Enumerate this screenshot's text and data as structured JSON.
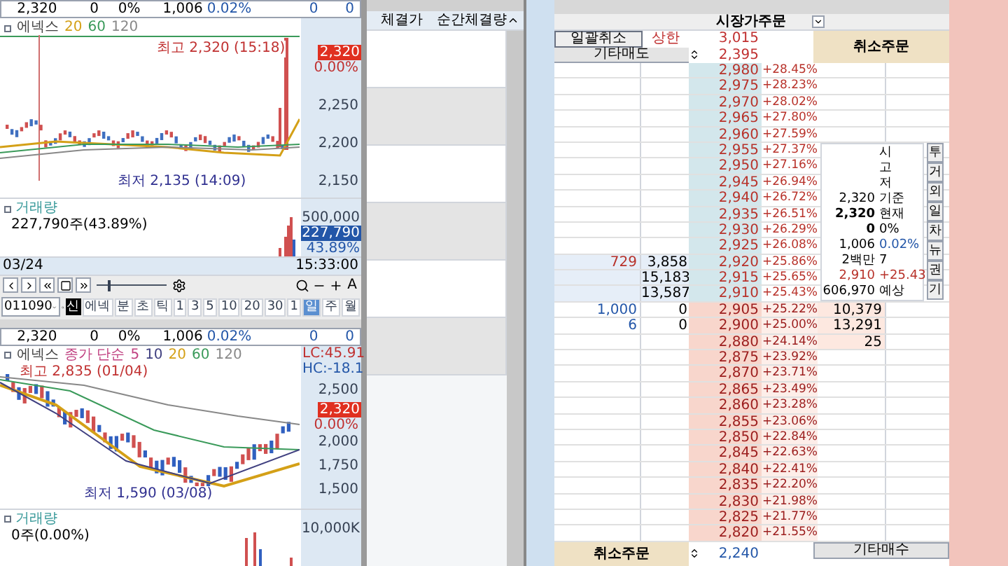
{
  "chart_panels": [
    {
      "quote": [
        {
          "text": "2,320",
          "kind": "plain"
        },
        {
          "text": "0",
          "kind": "plain"
        },
        {
          "text": "0%",
          "kind": "plain"
        },
        {
          "text": "1,006",
          "kind": "plain"
        },
        {
          "text": "0.02%",
          "kind": "blue"
        },
        {
          "text": "0",
          "kind": "blue"
        },
        {
          "text": "0",
          "kind": "blue"
        }
      ],
      "legend": [
        {
          "text": "에넥스",
          "color": "#404040"
        },
        {
          "text": "20",
          "color": "#d4a017"
        },
        {
          "text": "60",
          "color": "#3a9a5a"
        },
        {
          "text": "120",
          "color": "#888888"
        }
      ],
      "high_label": "최고 2,320 (15:18)",
      "low_label": "최저 2,135 (14:09)",
      "y_ticks": [
        "2,250",
        "2,200",
        "2,150"
      ],
      "price_tag": "2,320",
      "price_change": "0.00%",
      "volume": {
        "title": "거래량",
        "value": "227,790주(43.89%)",
        "tick": "500,000",
        "tag": "227,790",
        "tag_change": "43.89%"
      },
      "date": "03/24",
      "time": "15:33:00",
      "zoom_label": "A",
      "playback_slider": {
        "level": 0.15
      },
      "code_bar": {
        "code": "011090",
        "items": [
          {
            "label": "신",
            "kind": "badge"
          },
          {
            "label": "에넥",
            "kind": "tab",
            "selected": false
          },
          {
            "label": "분",
            "kind": "tab",
            "selected": false
          },
          {
            "label": "초",
            "kind": "tab",
            "selected": false
          },
          {
            "label": "틱",
            "kind": "tab",
            "selected": false
          },
          {
            "label": "1",
            "kind": "tab",
            "selected": false
          },
          {
            "label": "3",
            "kind": "tab",
            "selected": false
          },
          {
            "label": "5",
            "kind": "tab",
            "selected": false
          },
          {
            "label": "10",
            "kind": "tab",
            "selected": false
          },
          {
            "label": "20",
            "kind": "tab",
            "selected": false
          },
          {
            "label": "30",
            "kind": "tab",
            "selected": false
          },
          {
            "label": "1",
            "kind": "tab",
            "selected": false
          },
          {
            "label": "일",
            "kind": "tab",
            "selected": true
          },
          {
            "label": "주",
            "kind": "tab",
            "selected": false
          },
          {
            "label": "월",
            "kind": "tab",
            "selected": false
          }
        ]
      }
    },
    {
      "quote": [
        {
          "text": "2,320",
          "kind": "plain"
        },
        {
          "text": "0",
          "kind": "plain"
        },
        {
          "text": "0%",
          "kind": "plain"
        },
        {
          "text": "1,006",
          "kind": "plain"
        },
        {
          "text": "0.02%",
          "kind": "blue"
        },
        {
          "text": "0",
          "kind": "blue"
        },
        {
          "text": "0",
          "kind": "blue"
        }
      ],
      "legend": [
        {
          "text": "에넥스",
          "color": "#404040"
        },
        {
          "text": "종가 단순",
          "color": "#c04080"
        },
        {
          "text": "5",
          "color": "#c04080"
        },
        {
          "text": "10",
          "color": "#404080"
        },
        {
          "text": "20",
          "color": "#d4a017"
        },
        {
          "text": "60",
          "color": "#3a9a5a"
        },
        {
          "text": "120",
          "color": "#888888"
        }
      ],
      "high_label": "최고 2,835 (01/04)",
      "low_label": "최저 1,590 (03/08)",
      "indicators": [
        "LC:45.91",
        "HC:-18.1"
      ],
      "y_ticks": [
        "2,500",
        "2,000",
        "1,750",
        "1,500"
      ],
      "price_tag": "2,320",
      "price_change": "0.00%",
      "volume": {
        "title": "거래량",
        "value": "0주(0.00%)",
        "tick": "10,000K"
      }
    }
  ],
  "trades": {
    "columns": [
      "체결가",
      "순간체결량"
    ]
  },
  "order_book": {
    "header": "시장가주문",
    "cancel_all": "일괄취소",
    "upper_limit": "상한",
    "upper_price": "3,015",
    "other_sell": "기타매도",
    "start_price": "2,395",
    "cancel_order_top": "취소주문",
    "rows": [
      {
        "kind": "sell",
        "price": "2,980",
        "change": "+28.45%"
      },
      {
        "kind": "sell",
        "price": "2,975",
        "change": "+28.23%"
      },
      {
        "kind": "sell",
        "price": "2,970",
        "change": "+28.02%"
      },
      {
        "kind": "sell",
        "price": "2,965",
        "change": "+27.80%"
      },
      {
        "kind": "sell",
        "price": "2,960",
        "change": "+27.59%"
      },
      {
        "kind": "sell",
        "price": "2,955",
        "change": "+27.37%"
      },
      {
        "kind": "sell",
        "price": "2,950",
        "change": "+27.16%"
      },
      {
        "kind": "sell",
        "price": "2,945",
        "change": "+26.94%"
      },
      {
        "kind": "sell",
        "price": "2,940",
        "change": "+26.72%"
      },
      {
        "kind": "sell",
        "price": "2,935",
        "change": "+26.51%"
      },
      {
        "kind": "sell",
        "price": "2,930",
        "change": "+26.29%"
      },
      {
        "kind": "sell",
        "price": "2,925",
        "change": "+26.08%"
      },
      {
        "kind": "sell",
        "price": "2,920",
        "change": "+25.86%",
        "column_1": "729",
        "column_2": "3,858"
      },
      {
        "kind": "sell",
        "price": "2,915",
        "change": "+25.65%",
        "column_2": "15,183"
      },
      {
        "kind": "sell",
        "price": "2,910",
        "change": "+25.43%",
        "column_2": "13,587"
      },
      {
        "kind": "buy",
        "price": "2,905",
        "change": "+25.22%",
        "column_1": "1,000",
        "column_2": "0",
        "column_5": "10,379"
      },
      {
        "kind": "buy",
        "price": "2,900",
        "change": "+25.00%",
        "column_1": "6",
        "column_2": "0",
        "column_5": "13,291"
      },
      {
        "kind": "buy",
        "price": "2,880",
        "change": "+24.14%",
        "column_5": "25"
      },
      {
        "kind": "buy",
        "price": "2,875",
        "change": "+23.92%"
      },
      {
        "kind": "buy",
        "price": "2,870",
        "change": "+23.71%"
      },
      {
        "kind": "buy",
        "price": "2,865",
        "change": "+23.49%"
      },
      {
        "kind": "buy",
        "price": "2,860",
        "change": "+23.28%"
      },
      {
        "kind": "buy",
        "price": "2,855",
        "change": "+23.06%"
      },
      {
        "kind": "buy",
        "price": "2,850",
        "change": "+22.84%"
      },
      {
        "kind": "buy",
        "price": "2,845",
        "change": "+22.63%"
      },
      {
        "kind": "buy",
        "price": "2,840",
        "change": "+22.41%"
      },
      {
        "kind": "buy",
        "price": "2,835",
        "change": "+22.20%"
      },
      {
        "kind": "buy",
        "price": "2,830",
        "change": "+21.98%"
      },
      {
        "kind": "buy",
        "price": "2,825",
        "change": "+21.77%"
      },
      {
        "kind": "buy",
        "price": "2,820",
        "change": "+21.55%"
      }
    ],
    "summary": [
      {
        "unit": "시",
        "kind": "plain"
      },
      {
        "unit": "고",
        "kind": "plain"
      },
      {
        "unit": "저",
        "kind": "plain"
      },
      {
        "amount": "2,320",
        "unit": "기준",
        "kind": "plain"
      },
      {
        "amount": "2,320",
        "unit": "현재",
        "kind": "bold"
      },
      {
        "amount": "0",
        "unit": "0%",
        "kind": "bold"
      },
      {
        "amount": "1,006",
        "unit": "0.02%",
        "kind": "blue"
      },
      {
        "amount": "2백만",
        "unit": "7",
        "kind": "plain"
      },
      {
        "amount": "2,910",
        "unit": "+25.43",
        "kind": "red"
      },
      {
        "amount": "606,970",
        "unit": "예상",
        "kind": "plain"
      }
    ],
    "side_buttons": [
      "투",
      "거",
      "외",
      "일",
      "차",
      "뉴",
      "권",
      "기"
    ],
    "cancel_order_bottom": "취소주문",
    "end_price": "2,240",
    "other_buy": "기타매수"
  }
}
